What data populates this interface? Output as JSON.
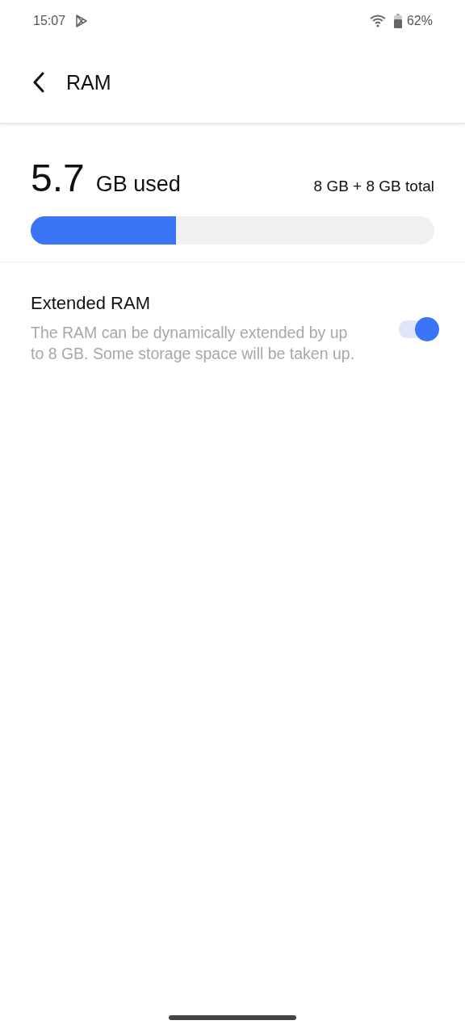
{
  "status_bar": {
    "time": "15:07",
    "battery": "62%"
  },
  "app_bar": {
    "title": "RAM"
  },
  "usage": {
    "amount": "5.7",
    "unit": "GB used",
    "total": "8 GB + 8 GB total",
    "level": 0.36
  },
  "settings": [
    {
      "kind": "switch",
      "title": "Extended RAM",
      "description": "The RAM can be dynamically extended by up to 8 GB. Some storage space will be taken up.",
      "on": true
    }
  ]
}
